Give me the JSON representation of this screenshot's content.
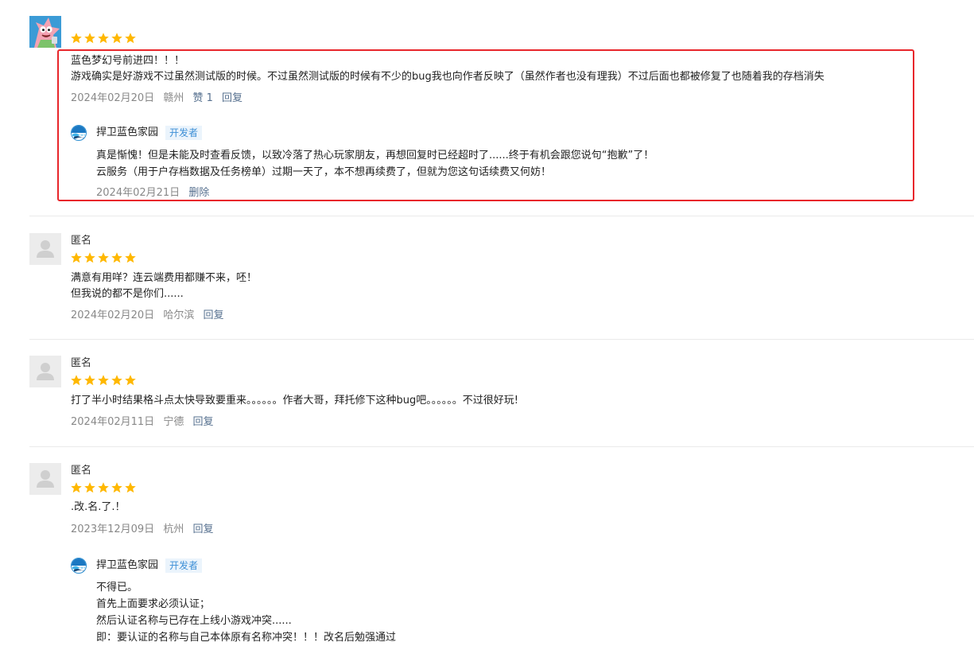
{
  "colors": {
    "star": "#ffb800",
    "highlight": "#e8262b",
    "badge_text": "#3d8fd6",
    "badge_bg": "#ebf4fc",
    "meta": "#888888",
    "link": "#56708f"
  },
  "reviews": [
    {
      "user": "",
      "avatar": "patrick-star-avatar",
      "rating": 5,
      "lines": [
        "蓝色梦幻号前进四！！！",
        "游戏确实是好游戏不过虽然测试版的时候。不过虽然测试版的时候有不少的bug我也向作者反映了（虽然作者也没有理我）不过后面也都被修复了也随着我的存档消失"
      ],
      "date": "2024年02月20日",
      "location": "赣州",
      "likes": "赞 1",
      "reply_label": "回复",
      "dev_reply": {
        "name": "捍卫蓝色家园",
        "badge": "开发者",
        "lines": [
          "真是惭愧！但是未能及时查看反馈，以致冷落了热心玩家朋友，再想回复时已经超时了......终于有机会跟您说句“抱歉”了！",
          "云服务（用于户存档数据及任务榜单）过期一天了，本不想再续费了，但就为您这句话续费又何妨！"
        ],
        "date": "2024年02月21日",
        "delete_label": "删除"
      }
    },
    {
      "user": "匿名",
      "avatar": "anonymous-avatar",
      "rating": 5,
      "lines": [
        "满意有用咩？连云端费用都赚不来，呸！",
        "但我说的都不是你们......"
      ],
      "date": "2024年02月20日",
      "location": "哈尔滨",
      "reply_label": "回复"
    },
    {
      "user": "匿名",
      "avatar": "anonymous-avatar",
      "rating": 5,
      "lines": [
        "打了半小时结果格斗点太快导致要重来。。。。。。作者大哥，拜托修下这种bug吧。。。。。。不过很好玩!"
      ],
      "date": "2024年02月11日",
      "location": "宁德",
      "reply_label": "回复"
    },
    {
      "user": "匿名",
      "avatar": "anonymous-avatar",
      "rating": 5,
      "lines": [
        ".改.名.了.！"
      ],
      "date": "2023年12月09日",
      "location": "杭州",
      "reply_label": "回复",
      "dev_reply": {
        "name": "捍卫蓝色家园",
        "badge": "开发者",
        "lines": [
          "不得已。",
          "首先上面要求必须认证；",
          "然后认证名称与已存在上线小游戏冲突......",
          "即：要认证的名称与自己本体原有名称冲突！！！改名后勉强通过"
        ]
      }
    }
  ]
}
